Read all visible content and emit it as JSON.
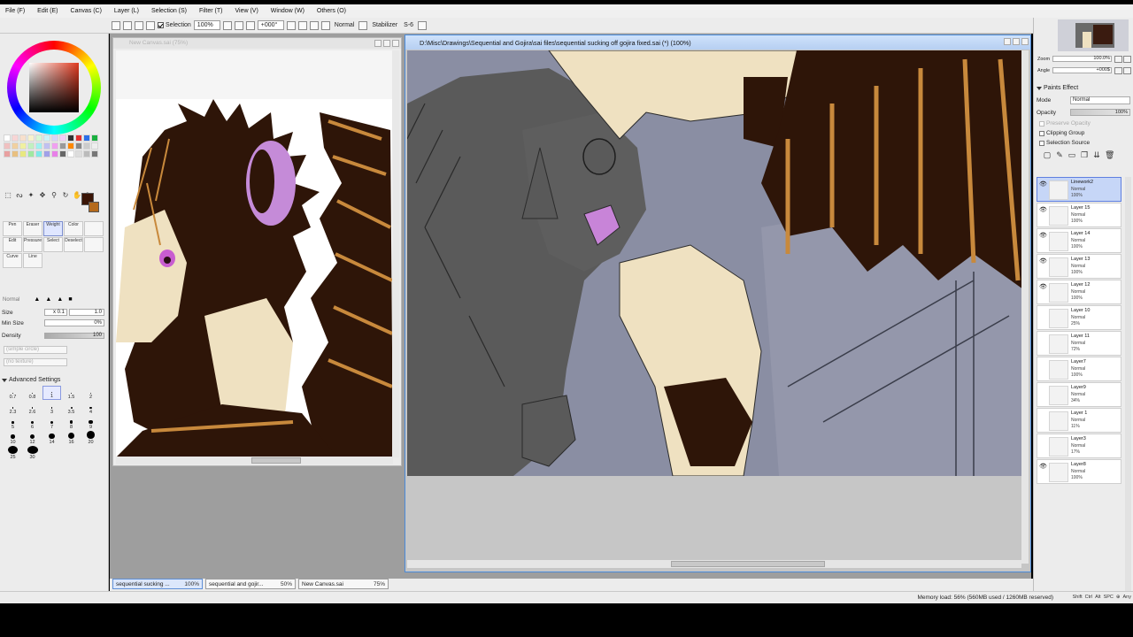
{
  "menubar": [
    {
      "label": "File (F)"
    },
    {
      "label": "Edit (E)"
    },
    {
      "label": "Canvas (C)"
    },
    {
      "label": "Layer (L)"
    },
    {
      "label": "Selection (S)"
    },
    {
      "label": "Filter (T)"
    },
    {
      "label": "View (V)"
    },
    {
      "label": "Window (W)"
    },
    {
      "label": "Others (O)"
    }
  ],
  "toolbar": {
    "selection_label": "Selection",
    "zoom_value": "100%",
    "rotation_value": "+000°",
    "blend_mode": "Normal",
    "stabilizer_label": "Stabilizer",
    "stabilizer_value": "S-6"
  },
  "tools_panel": {
    "row1": [
      "Pen",
      "Eraser",
      "Weight",
      "Color"
    ],
    "row2": [
      "Edit",
      "Pressure",
      "Select",
      "Deselect"
    ],
    "row3": [
      "Curve",
      "Line"
    ],
    "blend_mode": "Normal",
    "size_label": "Size",
    "size_multiplier": "x 0.1",
    "size_value": "1.0",
    "min_size_label": "Min Size",
    "min_size_value": "0%",
    "density_label": "Density",
    "density_value": "100",
    "shape_placeholder": "(simple circle)",
    "texture_placeholder": "(no texture)",
    "advanced_label": "Advanced Settings",
    "sizes": [
      "0.7",
      "0.8",
      "1",
      "1.5",
      "2",
      "2.3",
      "2.6",
      "3",
      "3.5",
      "4",
      "5",
      "6",
      "7",
      "8",
      "9",
      "10",
      "12",
      "14",
      "16",
      "20",
      "25",
      "30"
    ]
  },
  "canvas_windows": [
    {
      "title": "New Canvas.sai (75%)"
    },
    {
      "title": "D:\\Misc\\Drawings\\Sequential and Gojira\\sai files\\sequential sucking off gojira fixed.sai (*) (100%)"
    }
  ],
  "doc_tabs": [
    {
      "name": "sequential sucking ...",
      "zoom": "100%"
    },
    {
      "name": "sequential and gojir...",
      "zoom": "50%"
    },
    {
      "name": "New Canvas.sai",
      "zoom": "75%"
    }
  ],
  "navigator": {
    "zoom_label": "Zoom",
    "zoom_value": "100.0%",
    "angle_label": "Angle",
    "angle_value": "+000$"
  },
  "layer_props": {
    "paints_effect_label": "Paints Effect",
    "mode_label": "Mode",
    "mode_value": "Normal",
    "opacity_label": "Opacity",
    "opacity_value": "100%",
    "preserve_opacity_label": "Preserve Opacity",
    "clipping_group_label": "Clipping Group",
    "selection_source_label": "Selection Source"
  },
  "layers": [
    {
      "name": "Linework2",
      "mode": "Normal",
      "opacity": "100%",
      "visible": true,
      "active": true
    },
    {
      "name": "Layer 15",
      "mode": "Normal",
      "opacity": "100%",
      "visible": true,
      "active": false
    },
    {
      "name": "Layer 14",
      "mode": "Normal",
      "opacity": "100%",
      "visible": true,
      "active": false
    },
    {
      "name": "Layer 13",
      "mode": "Normal",
      "opacity": "100%",
      "visible": true,
      "active": false
    },
    {
      "name": "Layer 12",
      "mode": "Normal",
      "opacity": "100%",
      "visible": true,
      "active": false
    },
    {
      "name": "Layer 10",
      "mode": "Normal",
      "opacity": "25%",
      "visible": false,
      "active": false
    },
    {
      "name": "Layer 11",
      "mode": "Normal",
      "opacity": "72%",
      "visible": false,
      "active": false
    },
    {
      "name": "Layer7",
      "mode": "Normal",
      "opacity": "100%",
      "visible": false,
      "active": false
    },
    {
      "name": "Layer9",
      "mode": "Normal",
      "opacity": "34%",
      "visible": false,
      "active": false
    },
    {
      "name": "Layer 1",
      "mode": "Normal",
      "opacity": "11%",
      "visible": false,
      "active": false
    },
    {
      "name": "Layer3",
      "mode": "Normal",
      "opacity": "17%",
      "visible": false,
      "active": false
    },
    {
      "name": "Layer8",
      "mode": "Normal",
      "opacity": "100%",
      "visible": true,
      "active": false
    }
  ],
  "status": {
    "memory_load": "Memory load: 56% (560MB used / 1260MB reserved)",
    "keys": [
      "Shift",
      "Ctrl",
      "Alt",
      "SPC",
      "⊕",
      "Any"
    ]
  },
  "colors": {
    "primary": "#3a1506",
    "secondary": "#b56a1c",
    "active_accent": "#5f7fe0"
  }
}
